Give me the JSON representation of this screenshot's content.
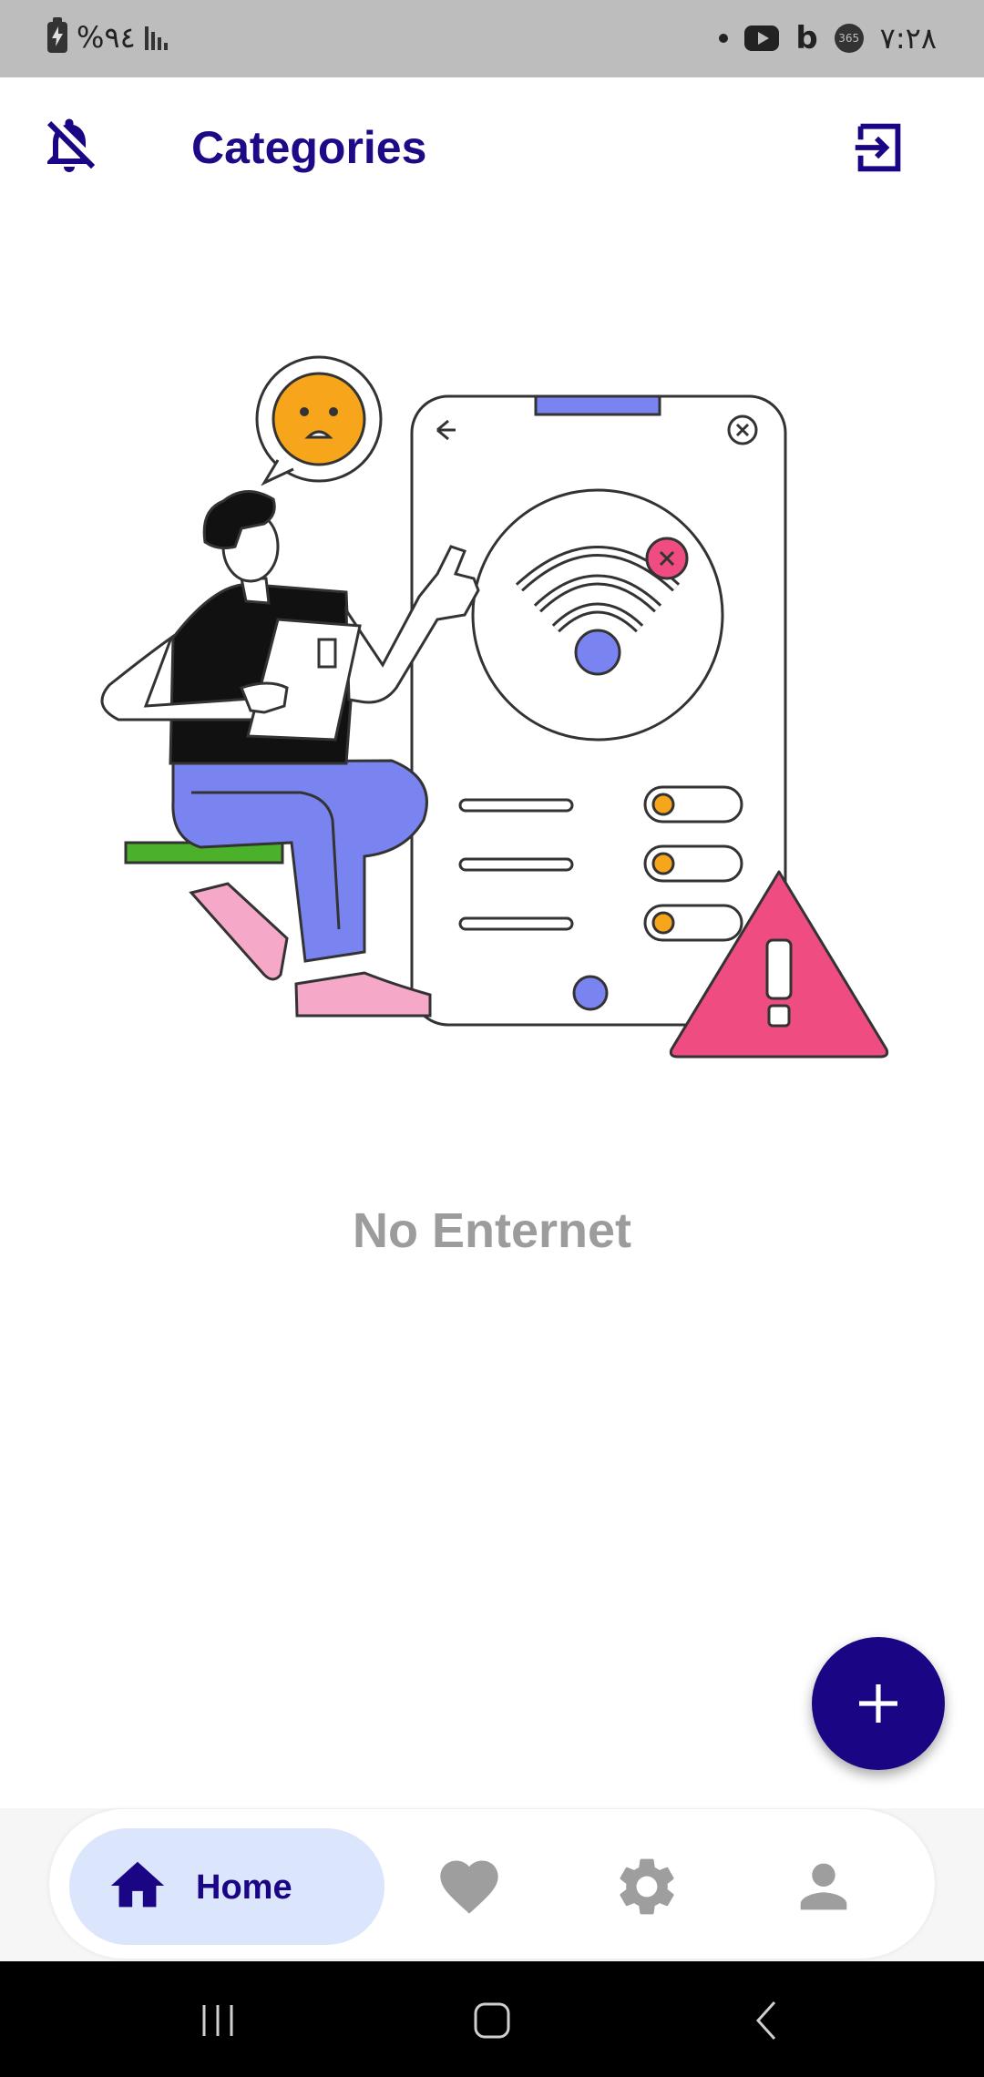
{
  "status_bar": {
    "battery_text": "%٩٤",
    "time": "٧:٢٨",
    "icons": [
      "battery-charging-icon",
      "signal-icon",
      "dot-icon",
      "youtube-icon",
      "bing-icon",
      "365-icon"
    ]
  },
  "app_bar": {
    "title": "Categories",
    "left_icon": "notifications-off-icon",
    "right_icon": "logout-icon"
  },
  "empty_state": {
    "illustration": "no-internet-illustration",
    "message": "No Enternet"
  },
  "fab": {
    "icon": "plus-icon"
  },
  "bottom_nav": {
    "items": [
      {
        "icon": "home-icon",
        "label": "Home",
        "selected": true
      },
      {
        "icon": "heart-icon",
        "selected": false
      },
      {
        "icon": "gear-icon",
        "selected": false
      },
      {
        "icon": "person-icon",
        "selected": false
      }
    ]
  },
  "system_nav": {
    "buttons": [
      "recents-button",
      "home-button",
      "back-button"
    ]
  },
  "colors": {
    "primary": "#1a0584",
    "title": "#1d0a87",
    "nav_selected_bg": "#dbe5fc",
    "message_gray": "#9c9c9c",
    "icon_gray": "#9e9e9e",
    "status_bar_bg": "#bdbdbd"
  }
}
